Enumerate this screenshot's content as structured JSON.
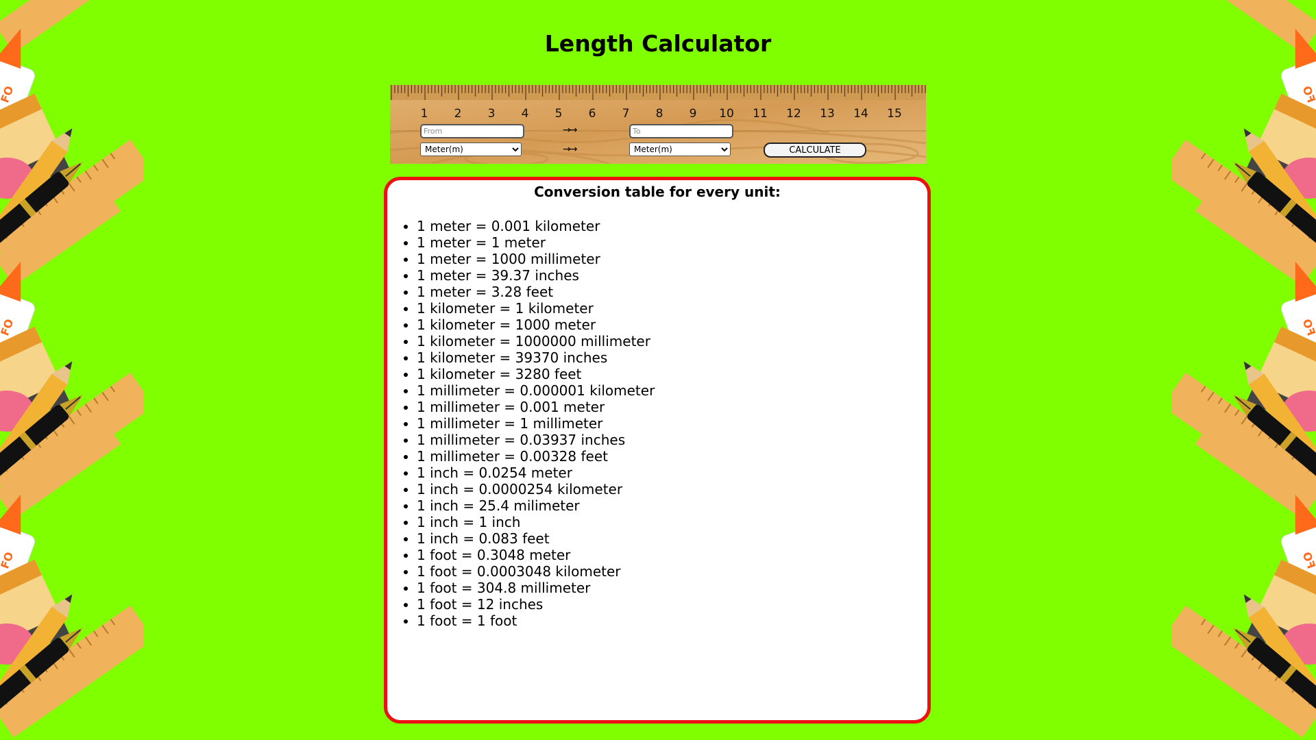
{
  "page": {
    "title": "Length Calculator"
  },
  "ruler": {
    "numbers": [
      "1",
      "2",
      "3",
      "4",
      "5",
      "6",
      "7",
      "8",
      "9",
      "10",
      "11",
      "12",
      "13",
      "14",
      "15"
    ]
  },
  "converter": {
    "from_placeholder": "From",
    "from_value": "",
    "to_placeholder": "To",
    "to_value": "",
    "arrow": "→→",
    "from_unit_selected": "Meter(m)",
    "to_unit_selected": "Meter(m)",
    "calculate_label": "CALCULATE"
  },
  "conversion_table": {
    "heading": "Conversion table for every unit:",
    "items": [
      "1 meter = 0.001 kilometer",
      "1 meter = 1 meter",
      "1 meter = 1000 millimeter",
      "1 meter = 39.37 inches",
      "1 meter = 3.28 feet",
      "1 kilometer = 1 kilometer",
      "1 kilometer = 1000 meter",
      "1 kilometer = 1000000 millimeter",
      "1 kilometer = 39370 inches",
      "1 kilometer = 3280 feet",
      "1 millimeter = 0.000001 kilometer",
      "1 millimeter = 0.001 meter",
      "1 millimeter = 1 millimeter",
      "1 millimeter = 0.03937 inches",
      "1 millimeter = 0.00328 feet",
      "1 inch = 0.0254 meter",
      "1 inch = 0.0000254 kilometer",
      "1 inch = 25.4 milimeter",
      "1 inch = 1 inch",
      "1 inch = 0.083 feet",
      "1 foot = 0.3048 meter",
      "1 foot = 0.0003048 kilometer",
      "1 foot = 304.8 millimeter",
      "1 foot = 12 inches",
      "1 foot = 1 foot"
    ]
  },
  "colors": {
    "background": "#7fff00",
    "box_border": "#ee1111",
    "ruler_wood": "#d9a35e"
  },
  "icons": {
    "border_art": [
      "ruler-icon",
      "pencil-icon",
      "fountain-pen-icon",
      "glue-bottle-icon",
      "eraser-icon"
    ]
  }
}
